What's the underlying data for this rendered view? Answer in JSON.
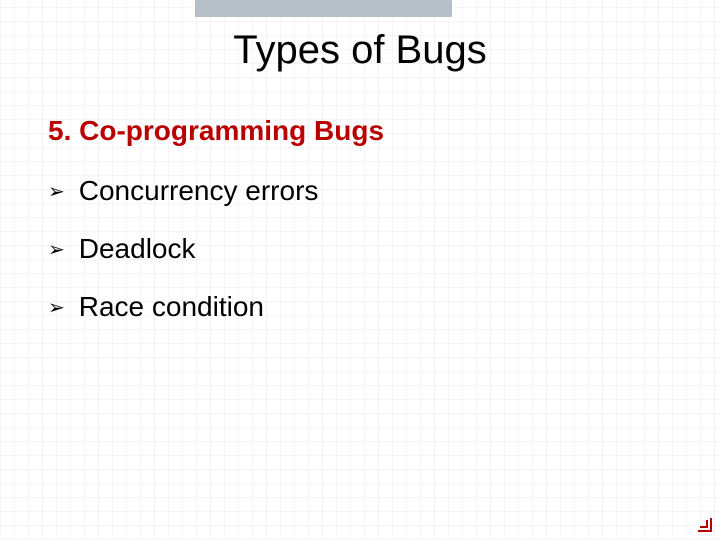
{
  "slide": {
    "title": "Types of Bugs",
    "subtitle": "5. Co-programming Bugs",
    "items": [
      {
        "label": "Concurrency errors"
      },
      {
        "label": "Deadlock"
      },
      {
        "label": "Race condition"
      }
    ]
  }
}
